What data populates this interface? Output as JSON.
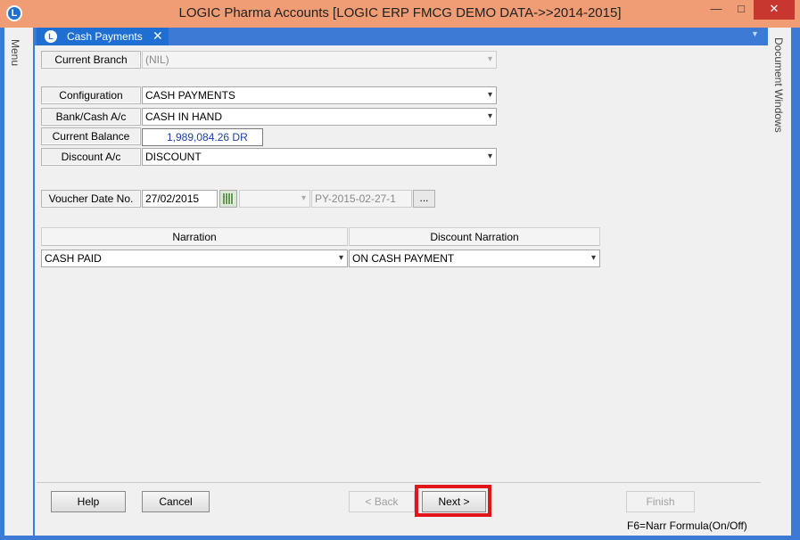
{
  "window": {
    "title": "LOGIC Pharma Accounts  [LOGIC ERP FMCG DEMO DATA->>2014-2015]",
    "app_icon": "logic-app-icon",
    "minimize": "—",
    "maximize": "□",
    "close": "✕"
  },
  "rails": {
    "left_label": "Menu",
    "right_label": "Document Windows"
  },
  "tab": {
    "label": "Cash Payments",
    "close": "✕"
  },
  "form": {
    "current_branch_label": "Current Branch",
    "current_branch_value": "(NIL)",
    "configuration_label": "Configuration",
    "configuration_value": "CASH PAYMENTS",
    "bank_cash_label": "Bank/Cash A/c",
    "bank_cash_value": "CASH IN HAND",
    "current_balance_label": "Current Balance",
    "current_balance_value": "1,989,084.26 DR",
    "discount_label": "Discount A/c",
    "discount_value": "DISCOUNT",
    "voucher_label": "Voucher Date  No.",
    "voucher_date": "27/02/2015",
    "voucher_series_value": "",
    "voucher_no": "PY-2015-02-27-1",
    "ellipsis": "..."
  },
  "grid": {
    "narration_header": "Narration",
    "discount_narration_header": "Discount Narration",
    "narration_value": "CASH PAID",
    "discount_narration_value": "ON CASH PAYMENT"
  },
  "buttons": {
    "help": "Help",
    "cancel": "Cancel",
    "back": "< Back",
    "next": "Next >",
    "finish": "Finish"
  },
  "status": {
    "hint": "F6=Narr Formula(On/Off)"
  },
  "colors": {
    "titlebar": "#f09c74",
    "frame": "#3d7ad6",
    "tab_active": "#1e6fd1",
    "highlight": "#e0161a",
    "balance_text": "#1b3fa8"
  }
}
